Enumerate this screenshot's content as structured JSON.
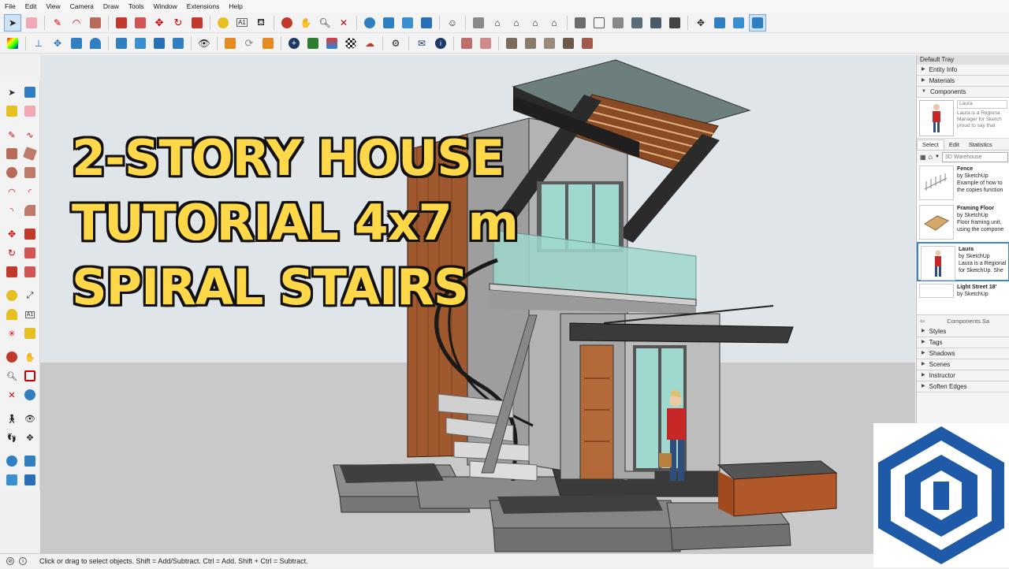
{
  "menu": [
    "File",
    "Edit",
    "View",
    "Camera",
    "Draw",
    "Tools",
    "Window",
    "Extensions",
    "Help"
  ],
  "overlay": {
    "line1": "2-STORY HOUSE",
    "line2": "TUTORIAL 4x7 m",
    "line3": "SPIRAL STAIRS"
  },
  "tray": {
    "title": "Default Tray",
    "panels_top": [
      "Entity Info",
      "Materials",
      "Components"
    ],
    "preview": {
      "name": "Laura",
      "desc1": "Laura is a Regiona",
      "desc2": "Manager for Sketch",
      "desc3": "proud to say that"
    },
    "tabs": [
      "Select",
      "Edit",
      "Statistics"
    ],
    "search_placeholder": "3D Warehouse",
    "components": [
      {
        "name": "Fence",
        "by": "by SketchUp",
        "d1": "Example of how to",
        "d2": "the copies function"
      },
      {
        "name": "Framing Floor",
        "by": "by SketchUp",
        "d1": "Floor framing unit,",
        "d2": "using the compone"
      },
      {
        "name": "Laura",
        "by": "by SketchUp",
        "d1": "Laura is a Regional",
        "d2": "for SketchUp. She"
      },
      {
        "name": "Light Street 18'",
        "by": "by SketchUp",
        "d1": "",
        "d2": ""
      }
    ],
    "footer": "Components Sa",
    "panels_bottom": [
      "Styles",
      "Tags",
      "Shadows",
      "Scenes",
      "Instructor",
      "Soften Edges"
    ]
  },
  "status": {
    "text": "Click or drag to select objects. Shift = Add/Subtract. Ctrl = Add. Shift + Ctrl = Subtract."
  },
  "colors": {
    "overlay_text": "#ffd84a",
    "sky": "#dfe5e9",
    "ground": "#c9c9c9",
    "logo_blue": "#1e5aa8",
    "wood": "#a0582e",
    "glass": "#9fd8cf"
  }
}
